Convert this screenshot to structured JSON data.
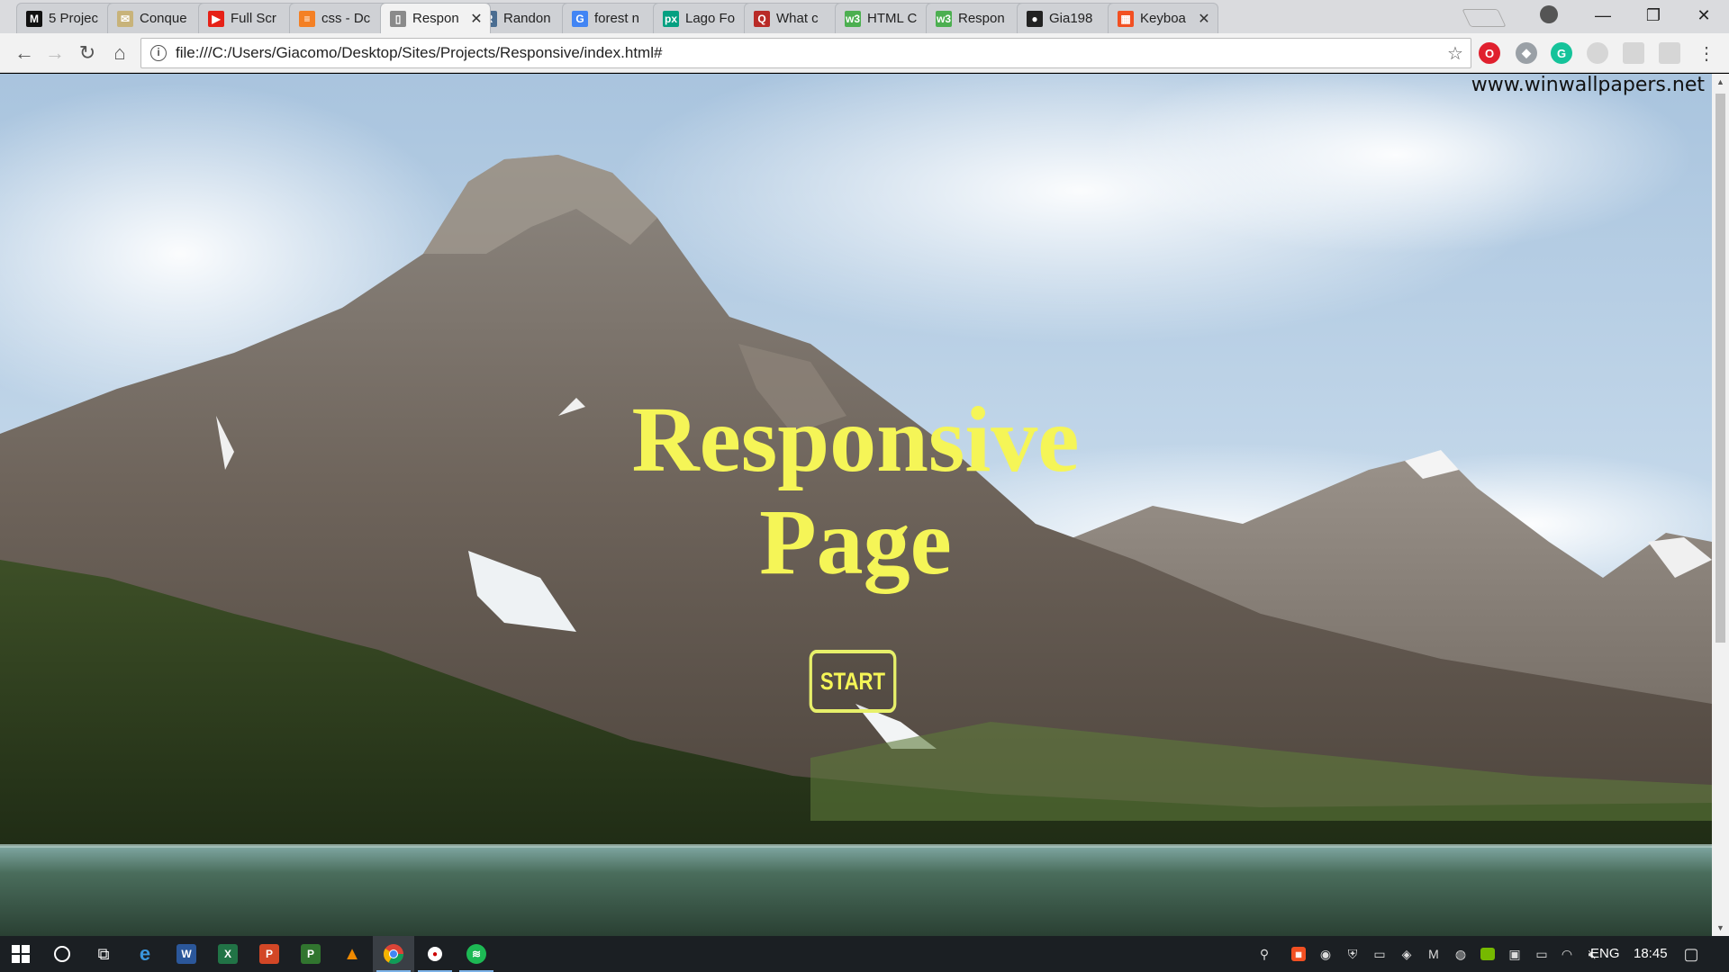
{
  "tabs": [
    {
      "title": "5 Projec",
      "icon": "medium-icon",
      "fav_text": "M",
      "fav_bg": "#111111"
    },
    {
      "title": "Conque",
      "icon": "mail-icon",
      "fav_text": "✉",
      "fav_bg": "#c8b37a"
    },
    {
      "title": "Full Scr",
      "icon": "youtube-icon",
      "fav_text": "▶",
      "fav_bg": "#e62117"
    },
    {
      "title": "css - Dc",
      "icon": "stackoverflow-icon",
      "fav_text": "≡",
      "fav_bg": "#f48024"
    },
    {
      "title": "Respon",
      "icon": "document-icon",
      "fav_text": "▯",
      "fav_bg": "#8a8a8a",
      "active": true
    },
    {
      "title": "Randon",
      "icon": "r-icon",
      "fav_text": "R",
      "fav_bg": "#4a6d91"
    },
    {
      "title": "forest n",
      "icon": "google-icon",
      "fav_text": "G",
      "fav_bg": "#4285f4"
    },
    {
      "title": "Lago Fo",
      "icon": "px-icon",
      "fav_text": "px",
      "fav_bg": "#05a081"
    },
    {
      "title": "What c",
      "icon": "quora-icon",
      "fav_text": "Q",
      "fav_bg": "#b92b27"
    },
    {
      "title": "HTML C",
      "icon": "w3schools-icon",
      "fav_text": "w3",
      "fav_bg": "#4caf50"
    },
    {
      "title": "Respon",
      "icon": "w3schools-icon",
      "fav_text": "w3",
      "fav_bg": "#4caf50"
    },
    {
      "title": "Gia198",
      "icon": "github-icon",
      "fav_text": "●",
      "fav_bg": "#222222"
    },
    {
      "title": "Keyboa",
      "icon": "microsoft-icon",
      "fav_text": "▦",
      "fav_bg": "#f25022"
    }
  ],
  "toolbar": {
    "url": "file:///C:/Users/Giacomo/Desktop/Sites/Projects/Responsive/index.html#"
  },
  "page": {
    "watermark": "www.winwallpapers.net",
    "title_line1": "Responsive",
    "title_line2": "Page",
    "start_label": "START"
  },
  "taskbar": {
    "language": "ENG",
    "time": "18:45"
  },
  "colors": {
    "title_yellow": "#f5f557",
    "button_border": "#e7f06a",
    "taskbar_bg": "#1b1f23"
  }
}
